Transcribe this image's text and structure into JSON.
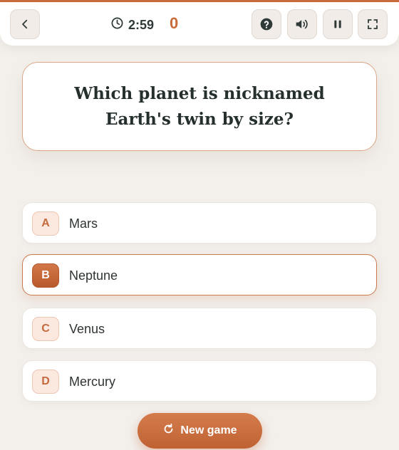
{
  "header": {
    "timer": "2:59",
    "score": "0"
  },
  "question": {
    "text": "Which planet is nicknamed Earth's twin by size?"
  },
  "answers": [
    {
      "letter": "A",
      "label": "Mars",
      "selected": false
    },
    {
      "letter": "B",
      "label": "Neptune",
      "selected": true
    },
    {
      "letter": "C",
      "label": "Venus",
      "selected": false
    },
    {
      "letter": "D",
      "label": "Mercury",
      "selected": false
    }
  ],
  "actions": {
    "new_game_label": "New game"
  },
  "icons": {
    "back": "chevron-left-icon",
    "timer": "clock-icon",
    "help": "question-icon",
    "sound": "speaker-icon",
    "pause": "pause-icon",
    "fullscreen": "fullscreen-icon",
    "new_game": "refresh-icon"
  },
  "colors": {
    "accent": "#c96a3a",
    "background": "#f3f0ec",
    "card": "#ffffff"
  }
}
